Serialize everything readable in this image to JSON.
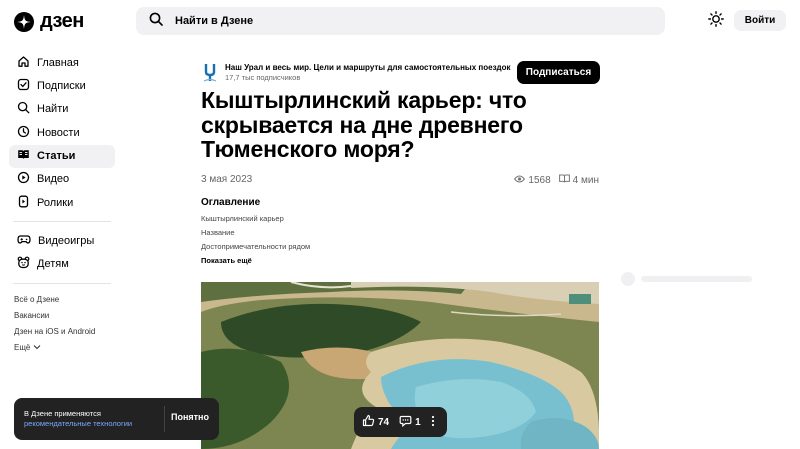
{
  "header": {
    "logo_text": "дзен",
    "search_placeholder": "Найти в Дзене",
    "login_label": "Войти"
  },
  "sidebar": {
    "items": [
      {
        "label": "Главная",
        "icon": "home-icon"
      },
      {
        "label": "Подписки",
        "icon": "subscriptions-icon"
      },
      {
        "label": "Найти",
        "icon": "search-icon"
      },
      {
        "label": "Новости",
        "icon": "news-icon"
      },
      {
        "label": "Статьи",
        "icon": "articles-icon",
        "active": true
      },
      {
        "label": "Видео",
        "icon": "video-icon"
      },
      {
        "label": "Ролики",
        "icon": "shorts-icon"
      }
    ],
    "extra_items": [
      {
        "label": "Видеоигры",
        "icon": "gamepad-icon"
      },
      {
        "label": "Детям",
        "icon": "kids-icon"
      }
    ],
    "footer_links": [
      "Всё о Дзене",
      "Вакансии",
      "Дзен на iOS и Android",
      "Ещё"
    ]
  },
  "channel": {
    "name": "Наш Урал и весь мир. Цели и маршруты для самостоятельных поездок",
    "subscribers": "17,7 тыс подписчиков",
    "subscribe_label": "Подписаться"
  },
  "article": {
    "title": "Кыштырлинский карьер: что скрывается на дне древнего Тюменского моря?",
    "date": "3 мая 2023",
    "views": "1568",
    "read_time": "4 мин"
  },
  "toc": {
    "title": "Оглавление",
    "items": [
      "Кыштырлинский карьер",
      "Название",
      "Достопримечательности рядом"
    ],
    "show_more": "Показать ещё"
  },
  "reactions": {
    "likes": "74",
    "comments": "1"
  },
  "cookie": {
    "text": "В Дзене применяются",
    "link": "рекомендательные технологии",
    "accept_label": "Понятно"
  },
  "colors": {
    "accent": "#000000",
    "surface": "#f1f1f3",
    "link": "#7aa9ff"
  }
}
